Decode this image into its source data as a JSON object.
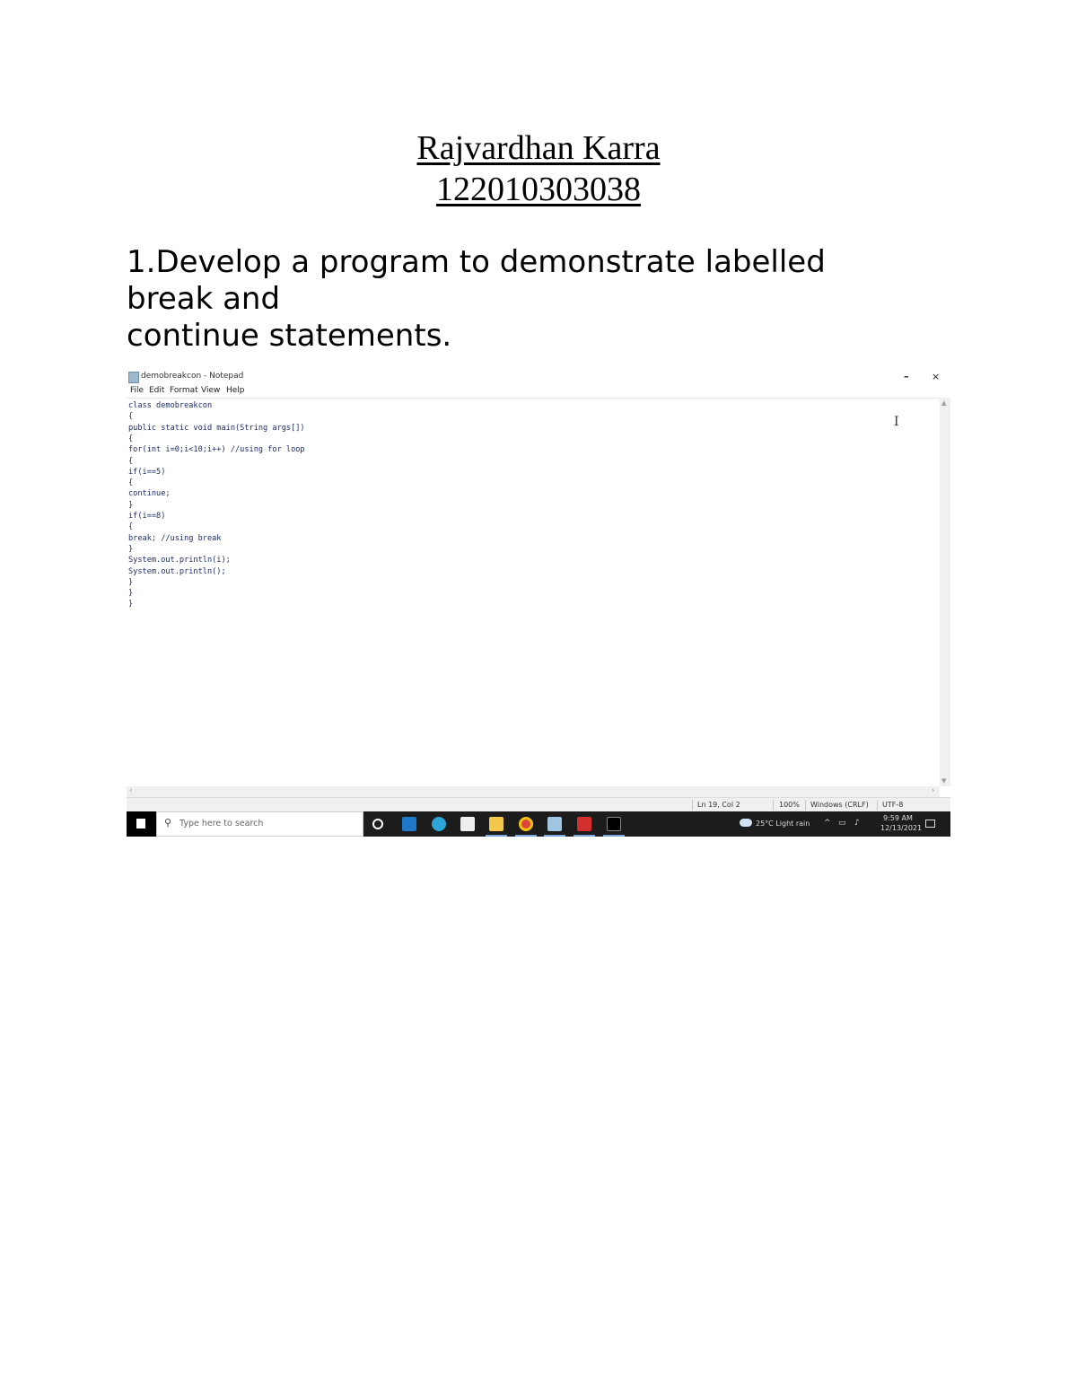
{
  "document": {
    "name": "Rajvardhan Karra",
    "roll_number": "122010303038",
    "question_lines": [
      "1.Develop a program to demonstrate labelled",
      "break and",
      "continue statements."
    ]
  },
  "screenshot": {
    "window_title": "demobreakcon - Notepad",
    "window_controls": {
      "minimize": "–",
      "close": "×"
    },
    "menu": [
      "File",
      "Edit",
      "Format",
      "View",
      "Help"
    ],
    "code_lines": [
      "class demobreakcon",
      "{",
      "public static void main(String args[])",
      "{",
      "for(int i=0;i<10;i++) //using for loop",
      "{",
      "if(i==5)",
      "{",
      "continue;",
      "}",
      "if(i==8)",
      "{",
      "break; //using break",
      "}",
      "System.out.println(i);",
      "System.out.println();",
      "}",
      "}",
      "}"
    ],
    "status": {
      "position": "Ln 19, Col 2",
      "zoom": "100%",
      "line_ending": "Windows (CRLF)",
      "encoding": "UTF-8"
    },
    "taskbar": {
      "search_placeholder": "Type here to search",
      "weather": "25°C Light rain",
      "time": "9:59 AM",
      "date": "12/13/2021",
      "app_icons": [
        "cortana-icon",
        "mail-icon",
        "edge-icon",
        "store-icon",
        "file-explorer-icon",
        "chrome-icon",
        "notepad-icon",
        "acrobat-icon",
        "terminal-icon"
      ]
    }
  }
}
